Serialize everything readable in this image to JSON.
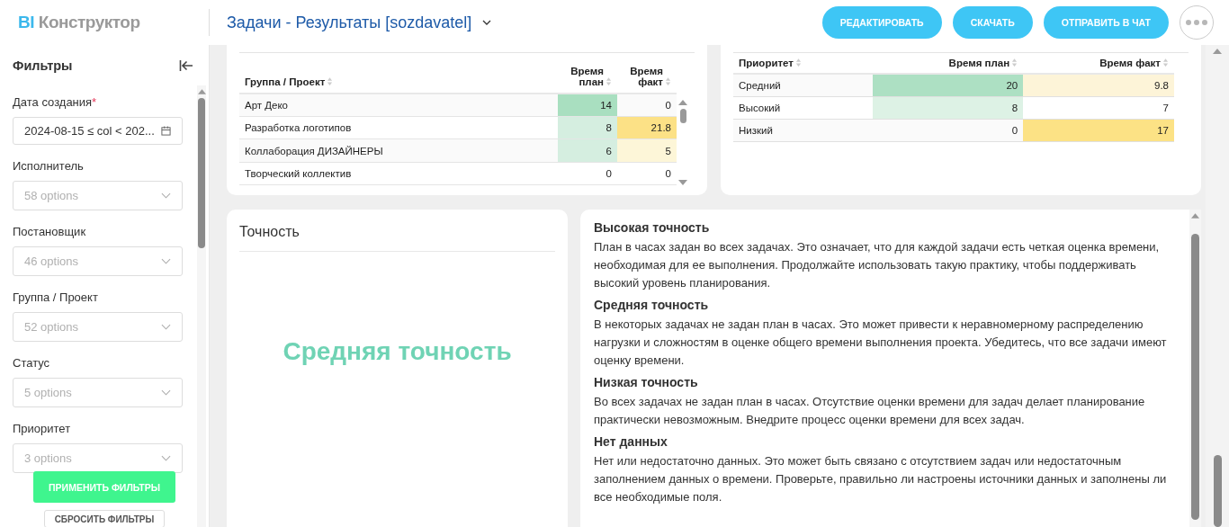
{
  "header": {
    "logo_prefix": "BI",
    "logo_text": "Конструктор",
    "dashboard_title": "Задачи - Результаты [sozdavatel]",
    "buttons": [
      "РЕДАКТИРОВАТЬ",
      "СКАЧАТЬ",
      "ОТПРАВИТЬ В ЧАТ"
    ]
  },
  "sidebar": {
    "title": "Фильтры",
    "filters": [
      {
        "label": "Дата создания",
        "mark": "*",
        "kind": "date",
        "value": "2024-08-15 ≤ col < 202..."
      },
      {
        "label": "Исполнитель",
        "kind": "select",
        "placeholder": "58 options"
      },
      {
        "label": "Постановщик",
        "kind": "select",
        "placeholder": "46 options"
      },
      {
        "label": "Группа / Проект",
        "kind": "select",
        "placeholder": "52 options"
      },
      {
        "label": "Статус",
        "kind": "select",
        "placeholder": "5 options"
      },
      {
        "label": "Приоритет",
        "kind": "select",
        "placeholder": "3 options"
      }
    ],
    "apply_button": "ПРИМЕНИТЬ ФИЛЬТРЫ",
    "reset_button": "СБРОСИТЬ ФИЛЬТРЫ"
  },
  "group_table": {
    "columns": [
      "Группа / Проект",
      "Время план",
      "Время факт"
    ],
    "rows": [
      {
        "cells": [
          {
            "value": "Арт Деко"
          },
          {
            "value": "14",
            "color": "#a9dfc0"
          },
          {
            "value": "0"
          }
        ]
      },
      {
        "cells": [
          {
            "value": "Разработка логотипов"
          },
          {
            "value": "8",
            "color": "#d5eee0"
          },
          {
            "value": "21.8",
            "color": "#fce186"
          }
        ]
      },
      {
        "cells": [
          {
            "value": "Коллаборация ДИЗАЙНЕРЫ"
          },
          {
            "value": "6",
            "color": "#d5eee0"
          },
          {
            "value": "5",
            "color": "#fdf6d8"
          }
        ]
      },
      {
        "cells": [
          {
            "value": "Творческий коллектив"
          },
          {
            "value": "0"
          },
          {
            "value": "0"
          }
        ]
      }
    ]
  },
  "priority_table": {
    "columns": [
      "Приоритет",
      "Время план",
      "Время факт"
    ],
    "rows": [
      {
        "cells": [
          {
            "value": "Средний"
          },
          {
            "value": "20",
            "color": "#ade0c3"
          },
          {
            "value": "9.8",
            "color": "#fdf4d8"
          }
        ]
      },
      {
        "cells": [
          {
            "value": "Высокий"
          },
          {
            "value": "8",
            "color": "#ddf2e5"
          },
          {
            "value": "7"
          }
        ]
      },
      {
        "cells": [
          {
            "value": "Низкий"
          },
          {
            "value": "0"
          },
          {
            "value": "17",
            "color": "#fce285"
          }
        ]
      }
    ]
  },
  "accuracy_card": {
    "title": "Точность",
    "result": "Средняя точность"
  },
  "accuracy_notes": [
    {
      "heading": "Высокая точность",
      "text": "План в часах задан во всех задачах. Это означает, что для каждой задачи есть четкая оценка времени, необходимая для ее выполнения. Продолжайте использовать такую практику, чтобы поддерживать высокий уровень планирования."
    },
    {
      "heading": "Средняя точность",
      "text": "В некоторых задачах не задан план в часах. Это может привести к неравномерному распределению нагрузки и сложностям в оценке общего времени выполнения проекта. Убедитесь, что все задачи имеют оценку времени."
    },
    {
      "heading": "Низкая точность",
      "text": "Во всех задачах не задан план в часах. Отсутствие оценки времени для задач делает планирование практически невозможным. Внедрите процесс оценки времени для всех задач."
    },
    {
      "heading": "Нет данных",
      "text": "Нет или недостаточно данных. Это может быть связано с отсутствием задач или недостаточным заполнением данных о времени. Проверьте, правильно ли настроены источники данных и заполнены ли все необходимые поля."
    }
  ]
}
